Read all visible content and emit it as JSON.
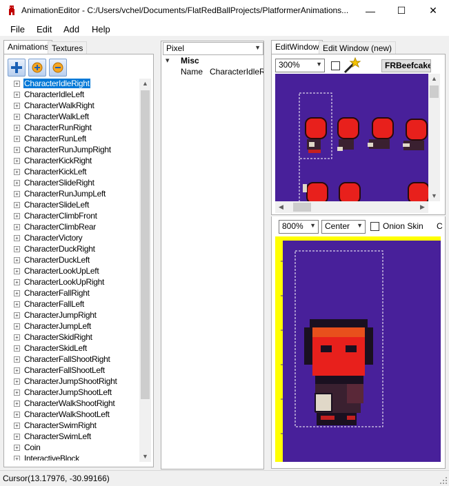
{
  "window": {
    "title": "AnimationEditor - C:/Users/vchel/Documents/FlatRedBallProjects/PlatformerAnimations...",
    "minimize": "—",
    "maximize": "☐",
    "close": "✕"
  },
  "menu": [
    "File",
    "Edit",
    "Add",
    "Help"
  ],
  "left_panel": {
    "tabs": [
      "Animations",
      "Textures"
    ],
    "toolbar": [
      "add-icon",
      "add-frame-icon",
      "remove-icon"
    ],
    "animations": [
      "CharacterIdleRight",
      "CharacterIdleLeft",
      "CharacterWalkRight",
      "CharacterWalkLeft",
      "CharacterRunRight",
      "CharacterRunLeft",
      "CharacterRunJumpRight",
      "CharacterKickRight",
      "CharacterKickLeft",
      "CharacterSlideRight",
      "CharacterRunJumpLeft",
      "CharacterSlideLeft",
      "CharacterClimbFront",
      "CharacterClimbRear",
      "CharacterVictory",
      "CharacterDuckRight",
      "CharacterDuckLeft",
      "CharacterLookUpLeft",
      "CharacterLookUpRight",
      "CharacterFallRight",
      "CharacterFallLeft",
      "CharacterJumpRight",
      "CharacterJumpLeft",
      "CharacterSkidRight",
      "CharacterSkidLeft",
      "CharacterFallShootRight",
      "CharacterFallShootLeft",
      "CharacterJumpShootRight",
      "CharacterJumpShootLeft",
      "CharacterWalkShootRight",
      "CharacterWalkShootLeft",
      "CharacterSwimRight",
      "CharacterSwimLeft",
      "Coin",
      "InteractiveBlock"
    ],
    "selected_index": 0
  },
  "properties": {
    "category_combo": "Pixel",
    "group": "Misc",
    "rows": [
      {
        "name": "Name",
        "value": "CharacterIdleRig"
      }
    ]
  },
  "edit_window": {
    "tabs": [
      "EditWindow",
      "Edit Window (new)"
    ],
    "zoom": "300%",
    "texture_button": "FRBeefcake",
    "colors": {
      "background": "#48209a",
      "character_red": "#e8201c",
      "axis": "#ffff00"
    }
  },
  "preview": {
    "zoom": "800%",
    "alignment": "Center",
    "onion_skin_label": "Onion Skin",
    "truncated_label": "C"
  },
  "status": {
    "cursor": "Cursor(13.17976, -30.99166)"
  }
}
